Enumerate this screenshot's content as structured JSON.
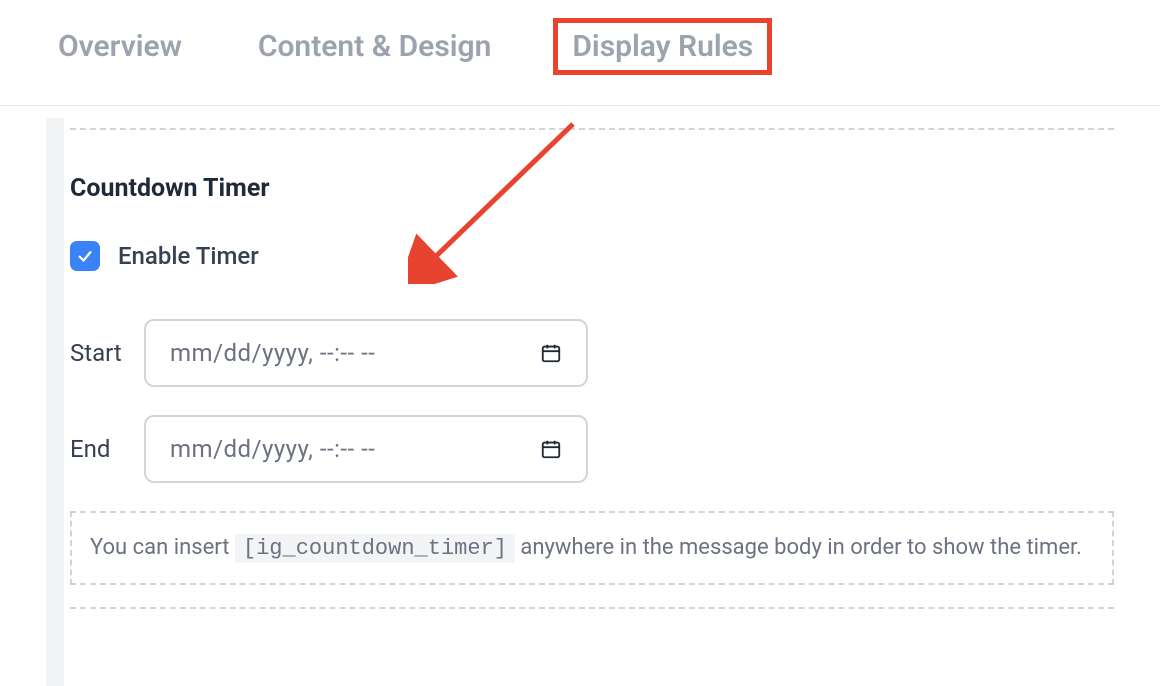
{
  "tabs": {
    "overview": "Overview",
    "content": "Content & Design",
    "display_rules": "Display Rules"
  },
  "section": {
    "title": "Countdown Timer",
    "enable_label": "Enable Timer",
    "start_label": "Start",
    "end_label": "End",
    "date_placeholder": "mm/dd/yyyy, --:-- --",
    "hint_pre": "You can insert ",
    "hint_code": "[ig_countdown_timer]",
    "hint_post": " anywhere in the message body in order to show the timer."
  }
}
